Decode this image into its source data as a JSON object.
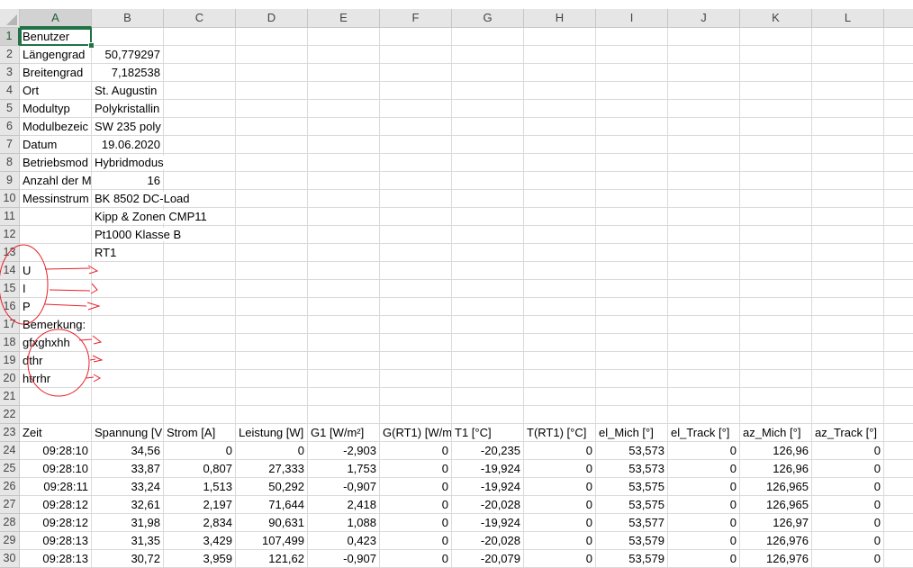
{
  "columns": [
    "A",
    "B",
    "C",
    "D",
    "E",
    "F",
    "G",
    "H",
    "I",
    "J",
    "K",
    "L",
    ""
  ],
  "active_cell": "A1",
  "rows": [
    {
      "n": "1",
      "cells": [
        "Benutzer"
      ]
    },
    {
      "n": "2",
      "cells": [
        "Längengrad",
        "50,779297"
      ]
    },
    {
      "n": "3",
      "cells": [
        "Breitengrad",
        "7,182538"
      ]
    },
    {
      "n": "4",
      "cells": [
        "Ort",
        "St. Augustin"
      ]
    },
    {
      "n": "5",
      "cells": [
        "Modultyp",
        "Polykristallin"
      ]
    },
    {
      "n": "6",
      "cells": [
        "Modulbezeic",
        "SW 235 poly"
      ]
    },
    {
      "n": "7",
      "cells": [
        "Datum",
        "19.06.2020"
      ]
    },
    {
      "n": "8",
      "cells": [
        "Betriebsmod",
        "Hybridmodus"
      ]
    },
    {
      "n": "9",
      "cells": [
        "Anzahl der M",
        "16"
      ]
    },
    {
      "n": "10",
      "cells": [
        "Messinstrum",
        "BK 8502 DC-Load"
      ]
    },
    {
      "n": "11",
      "cells": [
        "",
        "Kipp & Zonen CMP11"
      ]
    },
    {
      "n": "12",
      "cells": [
        "",
        "Pt1000 Klasse B"
      ]
    },
    {
      "n": "13",
      "cells": [
        "",
        "RT1"
      ]
    },
    {
      "n": "14",
      "cells": [
        "U"
      ]
    },
    {
      "n": "15",
      "cells": [
        "I"
      ]
    },
    {
      "n": "16",
      "cells": [
        "P"
      ]
    },
    {
      "n": "17",
      "cells": [
        "Bemerkung:"
      ]
    },
    {
      "n": "18",
      "cells": [
        "gfxghxhh"
      ]
    },
    {
      "n": "19",
      "cells": [
        "dthr"
      ]
    },
    {
      "n": "20",
      "cells": [
        "htrrhr"
      ]
    },
    {
      "n": "21",
      "cells": []
    },
    {
      "n": "22",
      "cells": []
    },
    {
      "n": "23",
      "cells": [
        "Zeit",
        "Spannung [V",
        "Strom [A]",
        "Leistung [W]",
        "G1 [W/m²]",
        "G(RT1) [W/m",
        "T1 [°C]",
        "T(RT1) [°C]",
        "el_Mich [°]",
        "el_Track [°]",
        "az_Mich [°]",
        "az_Track [°]"
      ]
    },
    {
      "n": "24",
      "cells": [
        "09:28:10",
        "34,56",
        "0",
        "0",
        "-2,903",
        "0",
        "-20,235",
        "0",
        "53,573",
        "0",
        "126,96",
        "0"
      ]
    },
    {
      "n": "25",
      "cells": [
        "09:28:10",
        "33,87",
        "0,807",
        "27,333",
        "1,753",
        "0",
        "-19,924",
        "0",
        "53,573",
        "0",
        "126,96",
        "0"
      ]
    },
    {
      "n": "26",
      "cells": [
        "09:28:11",
        "33,24",
        "1,513",
        "50,292",
        "-0,907",
        "0",
        "-19,924",
        "0",
        "53,575",
        "0",
        "126,965",
        "0"
      ]
    },
    {
      "n": "27",
      "cells": [
        "09:28:12",
        "32,61",
        "2,197",
        "71,644",
        "2,418",
        "0",
        "-20,028",
        "0",
        "53,575",
        "0",
        "126,965",
        "0"
      ]
    },
    {
      "n": "28",
      "cells": [
        "09:28:12",
        "31,98",
        "2,834",
        "90,631",
        "1,088",
        "0",
        "-19,924",
        "0",
        "53,577",
        "0",
        "126,97",
        "0"
      ]
    },
    {
      "n": "29",
      "cells": [
        "09:28:13",
        "31,35",
        "3,429",
        "107,499",
        "0,423",
        "0",
        "-20,028",
        "0",
        "53,579",
        "0",
        "126,976",
        "0"
      ]
    },
    {
      "n": "30",
      "cells": [
        "09:28:13",
        "30,72",
        "3,959",
        "121,62",
        "-0,907",
        "0",
        "-20,079",
        "0",
        "53,579",
        "0",
        "126,976",
        "0"
      ]
    }
  ],
  "colors": {
    "selection": "#217346",
    "annotation": "#e8202a"
  }
}
